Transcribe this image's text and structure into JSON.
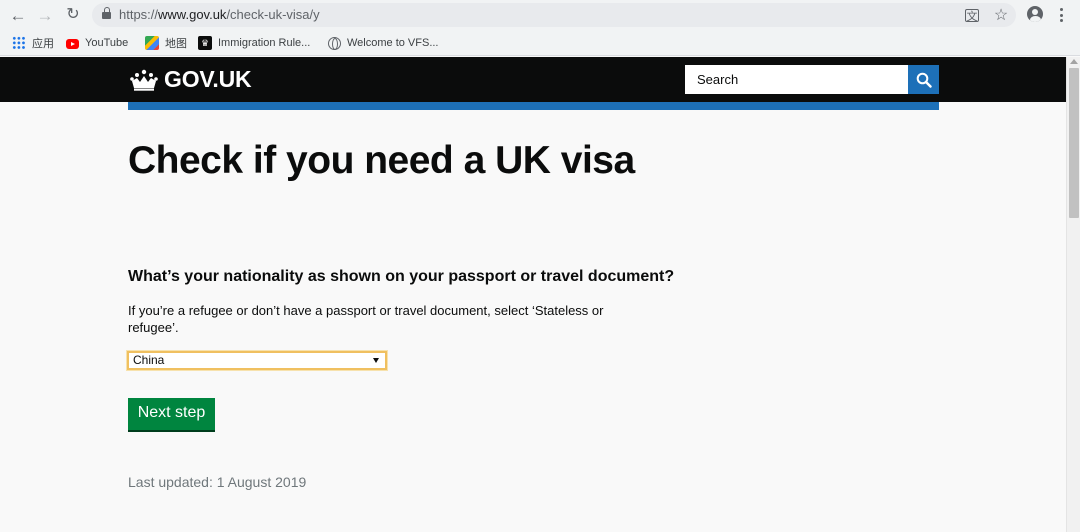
{
  "browser": {
    "url_prefix": "https://",
    "url_host": "www.gov.uk",
    "url_path": "/check-uk-visa/y",
    "bookmarks": [
      {
        "label": "应用",
        "icon": "apps-grid-icon"
      },
      {
        "label": "YouTube",
        "icon": "youtube-icon"
      },
      {
        "label": "地图",
        "icon": "maps-icon"
      },
      {
        "label": "Immigration Rule...",
        "icon": "govuk-crown-icon"
      },
      {
        "label": "Welcome to VFS...",
        "icon": "globe-icon"
      }
    ]
  },
  "header": {
    "logo_text": "GOV.UK",
    "search_placeholder": "Search",
    "brand_color": "#0b0c0c",
    "accent_color": "#1d70b8"
  },
  "main": {
    "title": "Check if you need a UK visa",
    "question": "What’s your nationality as shown on your passport or travel document?",
    "hint": "If you’re a refugee or don’t have a passport or travel document, select ‘Stateless or refugee’.",
    "nationality_selected": "China",
    "next_button": "Next step",
    "next_button_color": "#00853f",
    "last_updated": "Last updated: 1 August 2019"
  }
}
